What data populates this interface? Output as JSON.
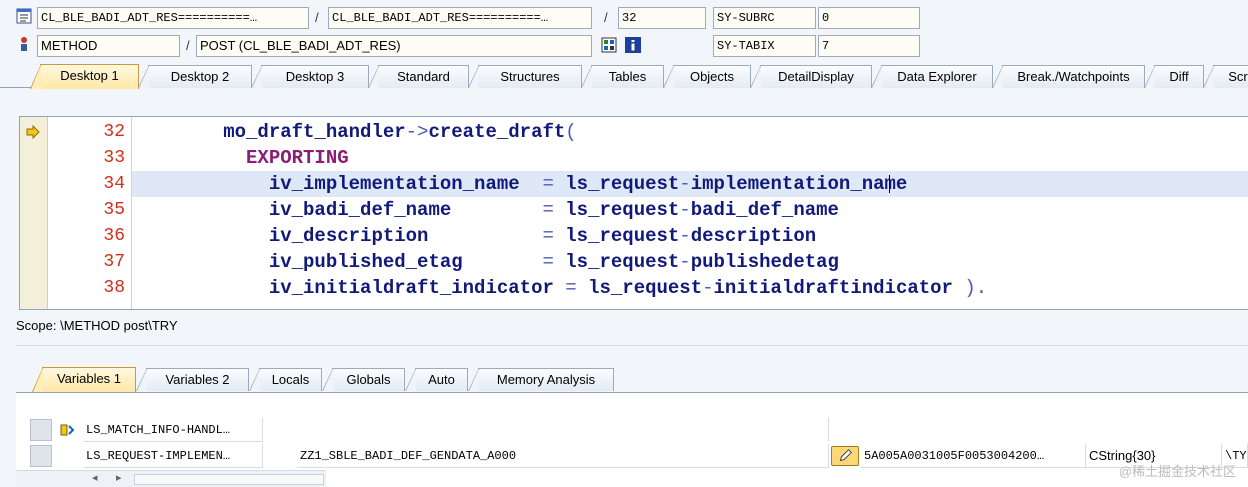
{
  "header": {
    "row1": {
      "program_field": "CL_BLE_BADI_ADT_RES==========…",
      "include_field": "CL_BLE_BADI_ADT_RES==========…",
      "line_field": "32",
      "sysvar_name": "SY-SUBRC",
      "sysvar_value": "0"
    },
    "row2": {
      "event_type": "METHOD",
      "event_name": "POST (CL_BLE_BADI_ADT_RES)",
      "sysvar_name": "SY-TABIX",
      "sysvar_value": "7"
    },
    "separators": [
      "/",
      "/",
      "/"
    ]
  },
  "desktop_tabs": [
    {
      "label": "Desktop 1",
      "active": true
    },
    {
      "label": "Desktop 2"
    },
    {
      "label": "Desktop 3"
    },
    {
      "label": "Standard"
    },
    {
      "label": "Structures"
    },
    {
      "label": "Tables"
    },
    {
      "label": "Objects"
    },
    {
      "label": "DetailDisplay"
    },
    {
      "label": "Data Explorer"
    },
    {
      "label": "Break./Watchpoints"
    },
    {
      "label": "Diff"
    },
    {
      "label": "Scrip"
    }
  ],
  "code": {
    "line_numbers": [
      "32",
      "33",
      "34",
      "35",
      "36",
      "37",
      "38"
    ],
    "current_line_index": 2,
    "exec_line_index": 0,
    "lines": [
      {
        "parts": [
          {
            "t": "        mo_draft_handler",
            "c": "id"
          },
          {
            "t": "->",
            "c": "op"
          },
          {
            "t": "create_draft",
            "c": "id"
          },
          {
            "t": "(",
            "c": "op"
          }
        ]
      },
      {
        "parts": [
          {
            "t": "          EXPORTING",
            "c": "kw"
          }
        ]
      },
      {
        "parts": [
          {
            "t": "            iv_implementation_name  ",
            "c": "id"
          },
          {
            "t": "=",
            "c": "op"
          },
          {
            "t": " ls_request",
            "c": "id"
          },
          {
            "t": "-",
            "c": "op"
          },
          {
            "t": "implementation_name",
            "c": "id"
          }
        ]
      },
      {
        "parts": [
          {
            "t": "            iv_badi_def_name        ",
            "c": "id"
          },
          {
            "t": "=",
            "c": "op"
          },
          {
            "t": " ls_request",
            "c": "id"
          },
          {
            "t": "-",
            "c": "op"
          },
          {
            "t": "badi_def_name",
            "c": "id"
          }
        ]
      },
      {
        "parts": [
          {
            "t": "            iv_description          ",
            "c": "id"
          },
          {
            "t": "=",
            "c": "op"
          },
          {
            "t": " ls_request",
            "c": "id"
          },
          {
            "t": "-",
            "c": "op"
          },
          {
            "t": "description",
            "c": "id"
          }
        ]
      },
      {
        "parts": [
          {
            "t": "            iv_published_etag       ",
            "c": "id"
          },
          {
            "t": "=",
            "c": "op"
          },
          {
            "t": " ls_request",
            "c": "id"
          },
          {
            "t": "-",
            "c": "op"
          },
          {
            "t": "publishedetag",
            "c": "id"
          }
        ]
      },
      {
        "parts": [
          {
            "t": "            iv_initialdraft_indicator ",
            "c": "id"
          },
          {
            "t": "=",
            "c": "op"
          },
          {
            "t": " ls_request",
            "c": "id"
          },
          {
            "t": "-",
            "c": "op"
          },
          {
            "t": "initialdraftindicator ",
            "c": "id"
          },
          {
            "t": ").",
            "c": "op"
          }
        ]
      }
    ]
  },
  "scope_text": "Scope: \\METHOD post\\TRY",
  "variable_tabs": [
    {
      "label": "Variables 1",
      "active": true
    },
    {
      "label": "Variables 2"
    },
    {
      "label": "Locals"
    },
    {
      "label": "Globals"
    },
    {
      "label": "Auto"
    },
    {
      "label": "Memory Analysis"
    }
  ],
  "variables": [
    {
      "name": "LS_MATCH_INFO-HANDL…",
      "value": "",
      "hex": "",
      "type": "",
      "extra": ""
    },
    {
      "name": "LS_REQUEST-IMPLEMEN…",
      "value": "ZZ1_SBLE_BADI_DEF_GENDATA_A000",
      "hex": "5A005A0031005F0053004200…",
      "type": "CString{30}",
      "extra": "\\TY"
    }
  ],
  "watermark": "@稀土掘金技术社区",
  "colors": {
    "line_number": "#d0301c",
    "code_identifier": "#111a7a",
    "keyword": "#8a1e73",
    "current_line_bg": "#dfe8f6",
    "active_tab": "#ffe7a6"
  },
  "icons": [
    "program-icon",
    "method-icon",
    "source-nav-icon",
    "info-icon",
    "exec-arrow-icon",
    "watch-icon",
    "edit-pencil-icon"
  ]
}
